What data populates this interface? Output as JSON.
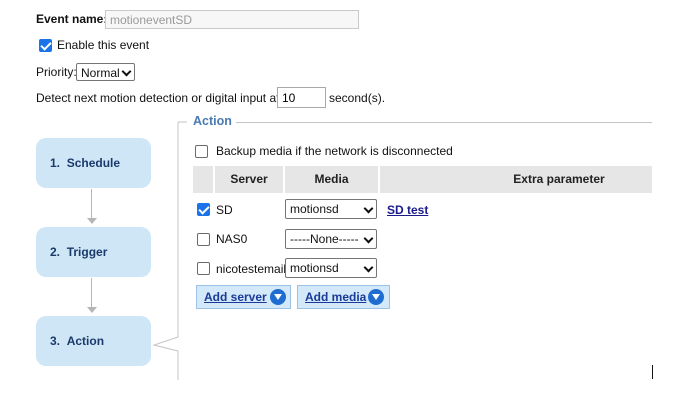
{
  "event": {
    "name_label": "Event name:",
    "name_value": "motioneventSD",
    "enable_label": "Enable this event",
    "enable_checked": true,
    "priority_label": "Priority:",
    "priority_value": "Normal",
    "detect_prefix": "Detect next motion detection or digital input after",
    "detect_value": "10",
    "detect_suffix": "second(s)."
  },
  "steps": [
    {
      "number": "1.",
      "label": "Schedule"
    },
    {
      "number": "2.",
      "label": "Trigger"
    },
    {
      "number": "3.",
      "label": "Action"
    }
  ],
  "action": {
    "legend": "Action",
    "backup_label": "Backup media if the network is disconnected",
    "backup_checked": false,
    "headers": {
      "server": "Server",
      "media": "Media",
      "extra": "Extra parameter"
    },
    "rows": [
      {
        "checked": true,
        "server": "SD",
        "media": "motionsd",
        "extra_link": "SD test"
      },
      {
        "checked": false,
        "server": "NAS0",
        "media": "-----None-----",
        "extra_link": ""
      },
      {
        "checked": false,
        "server": "nicotestemail",
        "media": "motionsd",
        "extra_link": ""
      }
    ],
    "add_server": "Add server",
    "add_media": "Add media"
  },
  "colors": {
    "accent": "#4a7ab0",
    "step_bg": "#cfe6f7",
    "button_bg": "#d3e8f8"
  }
}
